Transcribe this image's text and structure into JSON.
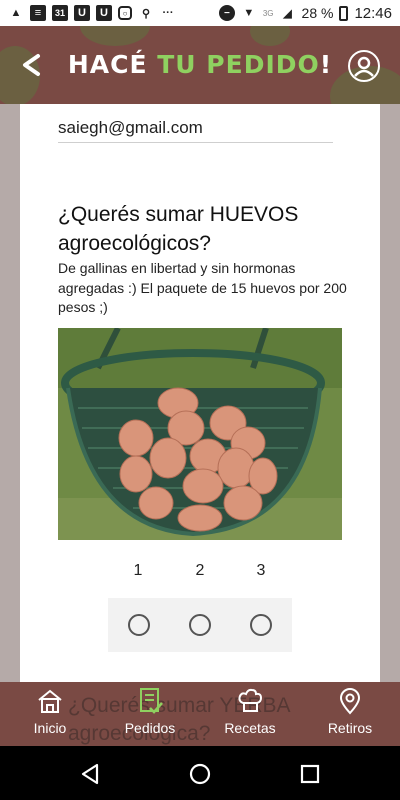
{
  "status_bar": {
    "icons_left": [
      "a-icon",
      "news-icon",
      "calendar-31-icon",
      "u-icon",
      "u-icon",
      "instagram-icon",
      "location-icon",
      "more-icon"
    ],
    "calendar_day": "31",
    "battery": "28 %",
    "time": "12:46",
    "network": "3G"
  },
  "header": {
    "title_part1": "HACÉ ",
    "title_part2": "TU PEDIDO",
    "title_part3": "!",
    "title_color_white": "#ffffff",
    "title_color_green": "#8fd160",
    "background": "#7a4a44"
  },
  "form": {
    "email_value": "saiegh@gmail.com",
    "question": "¿Querés sumar HUEVOS agroecológicos?",
    "description": "De gallinas en libertad y sin hormonas agregadas :) El paquete de 15 huevos por 200 pesos ;)",
    "options": [
      {
        "label": "1",
        "selected": false
      },
      {
        "label": "2",
        "selected": false
      },
      {
        "label": "3",
        "selected": false
      }
    ],
    "next_question": "¿Querés sumar YERBA agroecológica?"
  },
  "bottom_nav": {
    "items": [
      {
        "label": "Inicio",
        "icon": "home-icon",
        "active": false
      },
      {
        "label": "Pedidos",
        "icon": "orders-icon",
        "active": true
      },
      {
        "label": "Recetas",
        "icon": "chef-hat-icon",
        "active": false
      },
      {
        "label": "Retiros",
        "icon": "location-pin-icon",
        "active": false
      }
    ],
    "active_color": "#8fd160"
  }
}
